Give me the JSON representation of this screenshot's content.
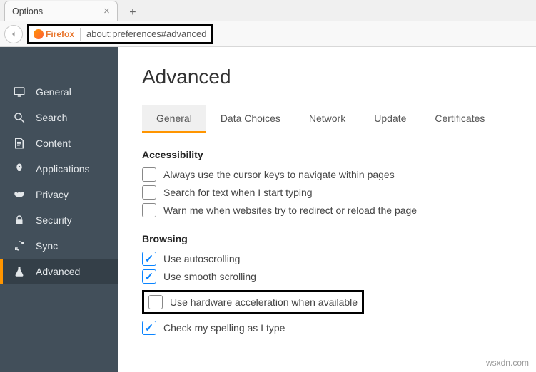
{
  "tab": {
    "title": "Options"
  },
  "addressbar": {
    "badge": "Firefox",
    "url": "about:preferences#advanced"
  },
  "sidebar": {
    "items": [
      {
        "label": "General"
      },
      {
        "label": "Search"
      },
      {
        "label": "Content"
      },
      {
        "label": "Applications"
      },
      {
        "label": "Privacy"
      },
      {
        "label": "Security"
      },
      {
        "label": "Sync"
      },
      {
        "label": "Advanced"
      }
    ]
  },
  "page": {
    "title": "Advanced",
    "tabs": [
      {
        "label": "General"
      },
      {
        "label": "Data Choices"
      },
      {
        "label": "Network"
      },
      {
        "label": "Update"
      },
      {
        "label": "Certificates"
      }
    ],
    "accessibility": {
      "title": "Accessibility",
      "cursor": "Always use the cursor keys to navigate within pages",
      "searchtext": "Search for text when I start typing",
      "warn": "Warn me when websites try to redirect or reload the page"
    },
    "browsing": {
      "title": "Browsing",
      "autoscroll": "Use autoscrolling",
      "smooth": "Use smooth scrolling",
      "hwaccel": "Use hardware acceleration when available",
      "spelling": "Check my spelling as I type"
    }
  },
  "watermark": "wsxdn.com"
}
